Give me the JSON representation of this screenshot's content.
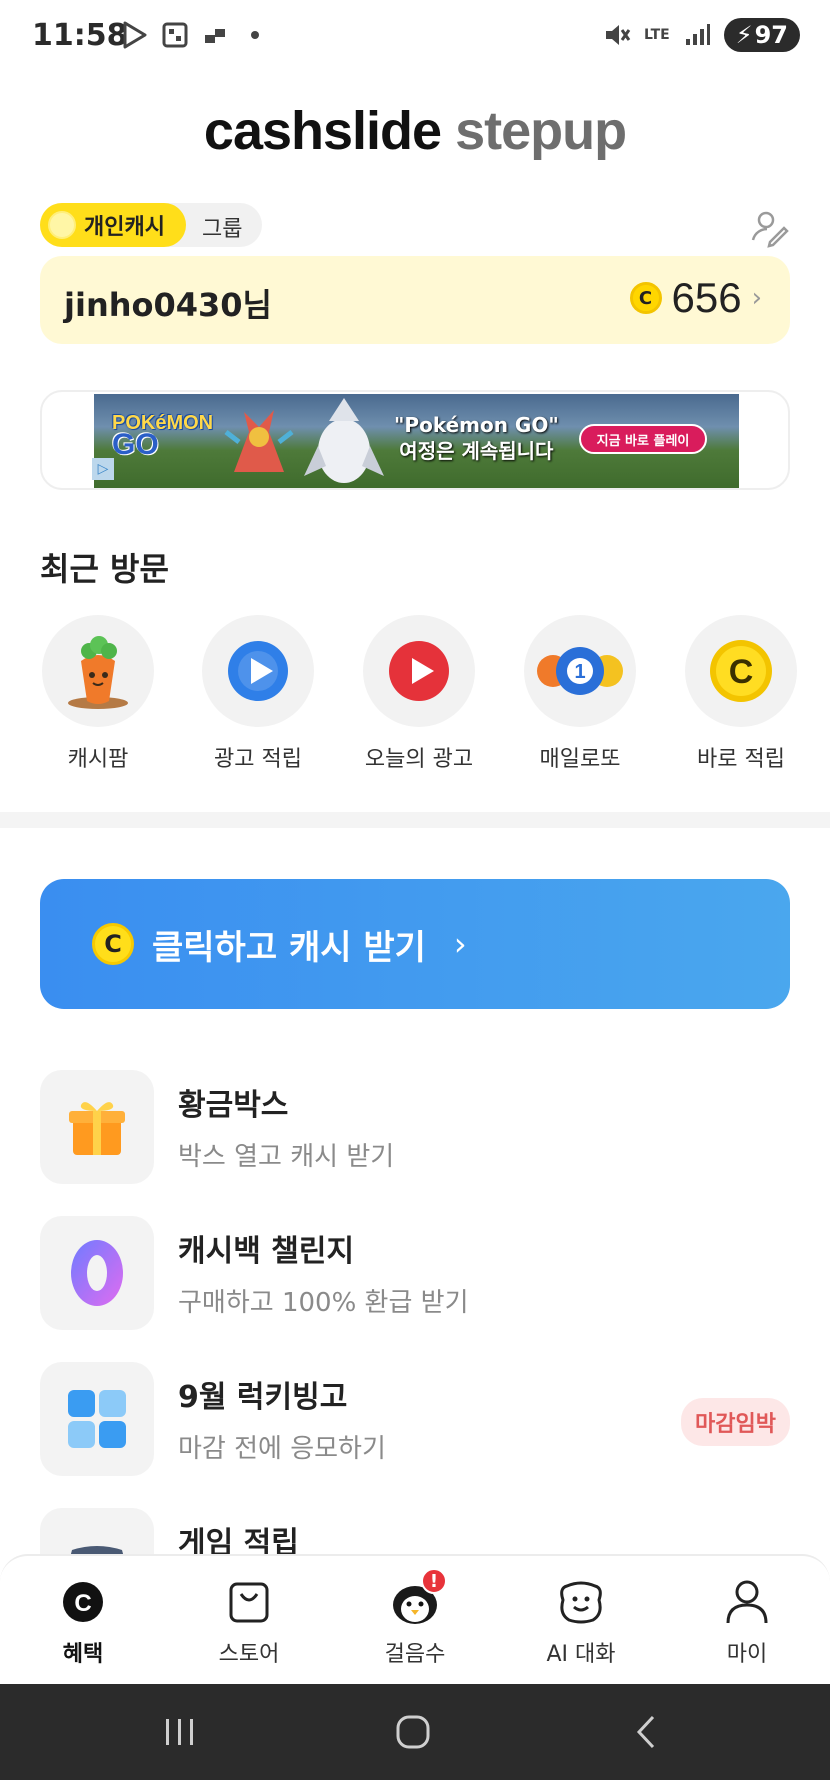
{
  "status_bar": {
    "time": "11:58",
    "battery": "97",
    "network": "LTE",
    "icons_left": [
      "play-store-icon",
      "qr-icon",
      "signal-boost-icon",
      "dot-icon"
    ],
    "icons_right": [
      "mute-icon",
      "lte-icon",
      "signal-icon",
      "battery-icon"
    ]
  },
  "header": {
    "logo_part1": "cashslide",
    "logo_part2": "stepup"
  },
  "toggle": {
    "personal_label": "개인캐시",
    "group_label": "그룹",
    "selected": "개인캐시"
  },
  "user": {
    "name": "jinho0430님",
    "points": "656",
    "coin_symbol": "C"
  },
  "banner": {
    "brand_line1": "POKéMON",
    "brand_line2": "GO",
    "headline_line1": "\"Pokémon GO\"",
    "headline_line2": "여정은 계속됩니다",
    "button_label": "지금 바로 플레이",
    "ad_mark": "▷"
  },
  "recent": {
    "title": "최근 방문",
    "items": [
      {
        "label": "캐시팜",
        "icon": "carrot-icon"
      },
      {
        "label": "광고 적립",
        "icon": "blue-play-icon"
      },
      {
        "label": "오늘의 광고",
        "icon": "red-play-icon"
      },
      {
        "label": "매일로또",
        "icon": "lotto-ball-icon"
      },
      {
        "label": "바로 적립",
        "icon": "gold-coin-icon"
      }
    ]
  },
  "cta": {
    "label": "클릭하고 캐시 받기",
    "coin_symbol": "C",
    "chevron": "›"
  },
  "list": [
    {
      "title": "황금박스",
      "subtitle": "박스 열고 캐시 받기",
      "icon": "gift-box-icon"
    },
    {
      "title": "캐시백 챌린지",
      "subtitle": "구매하고 100% 환급 받기",
      "icon": "zero-badge-icon"
    },
    {
      "title": "9월 럭키빙고",
      "subtitle": "마감 전에 응모하기",
      "icon": "bingo-grid-icon",
      "badge": "마감임박"
    },
    {
      "title": "게임 적립",
      "subtitle": "",
      "icon": "gamepad-icon"
    }
  ],
  "bottom_nav": [
    {
      "label": "혜택",
      "icon": "benefit-coin-icon",
      "active": true
    },
    {
      "label": "스토어",
      "icon": "shopping-bag-icon",
      "active": false
    },
    {
      "label": "걸음수",
      "icon": "penguin-icon",
      "active": false,
      "alert": "!"
    },
    {
      "label": "AI 대화",
      "icon": "ai-chat-icon",
      "active": false
    },
    {
      "label": "마이",
      "icon": "person-icon",
      "active": false
    }
  ],
  "colors": {
    "brand_yellow": "#ffde1a",
    "cta_blue": "#3a8ef0",
    "usercard_bg": "#fff9d4",
    "badge_red": "#e05858"
  }
}
